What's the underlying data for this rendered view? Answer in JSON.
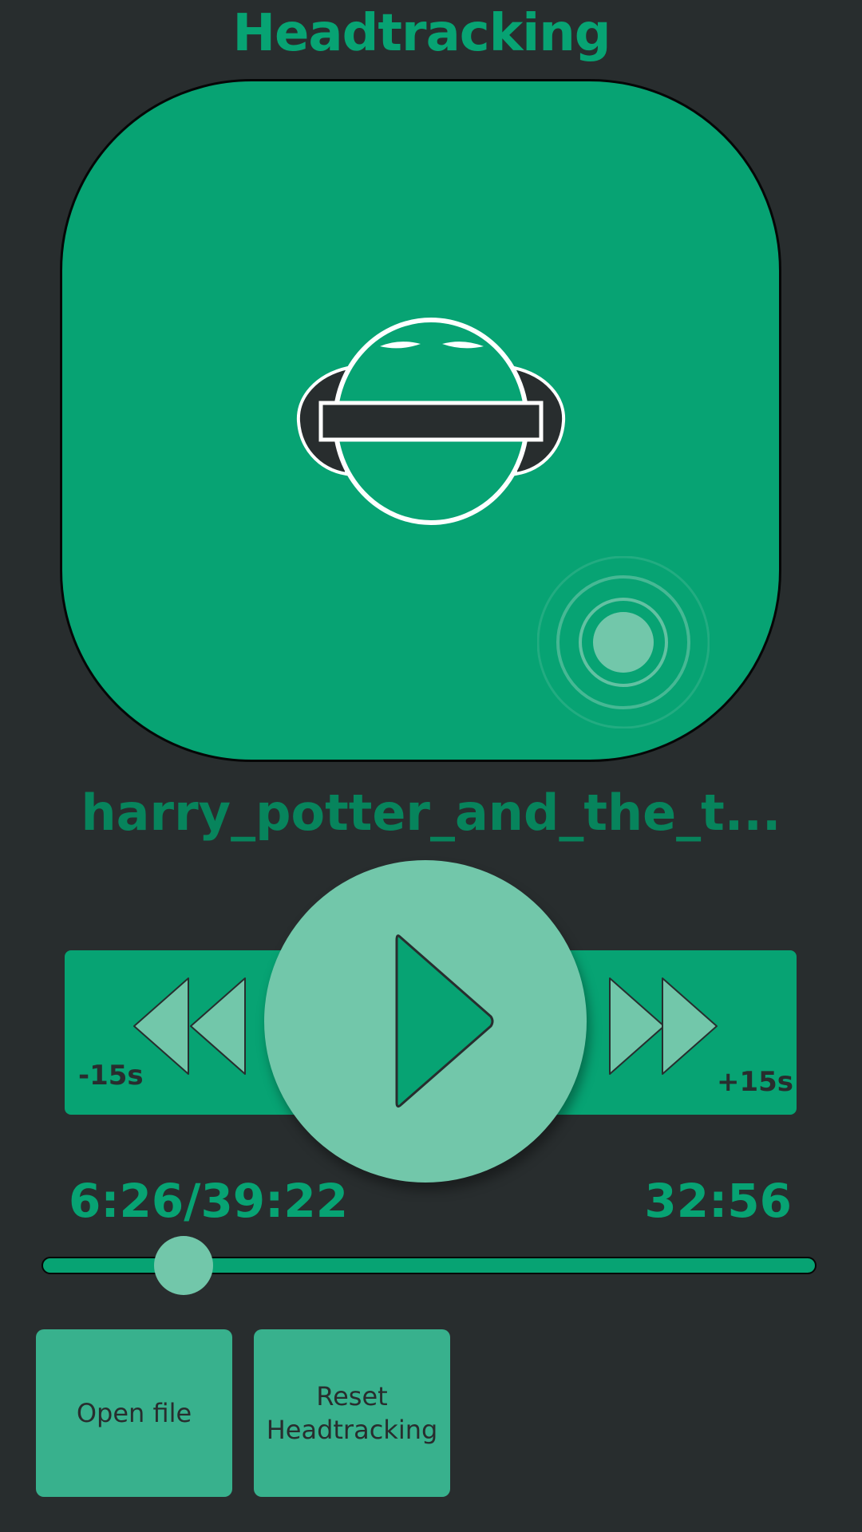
{
  "header": {
    "title": "Headtracking"
  },
  "headtracking_pad": {
    "center_icon": "headphones-head-icon",
    "knob_icon": "drag-knob-icon"
  },
  "player": {
    "filename": "harry_potter_and_the_t...",
    "skip_back_label": "-15s",
    "skip_forward_label": "+15s",
    "skip_back_icon": "rewind-icon",
    "skip_forward_icon": "fast-forward-icon",
    "play_icon": "play-icon",
    "elapsed_total": "6:26/39:22",
    "remaining": "32:56",
    "progress_fraction": 0.163
  },
  "actions": {
    "open_file_label": "Open file",
    "reset_headtracking_label": "Reset\nHeadtracking"
  },
  "colors": {
    "background": "#282d2e",
    "accent": "#07a373",
    "accent_light": "#72c7aa",
    "button": "#38b18d",
    "title": "#07a373",
    "filename": "#07845c"
  }
}
